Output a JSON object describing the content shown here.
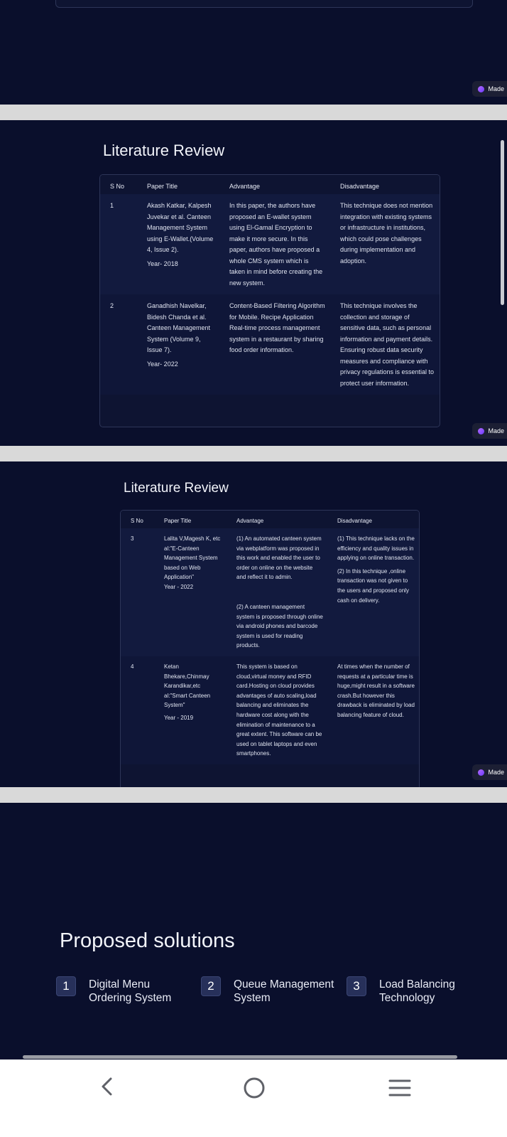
{
  "made_badge": "Made",
  "slide_lit1": {
    "title": "Literature Review",
    "headers": [
      "S No",
      "Paper Title",
      "Advantage",
      "Disadvantage"
    ],
    "rows": [
      {
        "sno": "1",
        "paper": "Akash Katkar, Kalpesh Juvekar et al. Canteen Management System using E-Wallet.(Volume 4, Issue 2).",
        "year": "Year- 2018",
        "advantage": "In this paper, the authors have proposed an E-wallet system using El-Gamal Encryption to make it more secure. In this paper, authors have proposed a whole CMS system which is taken in mind before creating the new system.",
        "disadvantage": "This technique does not mention integration with existing systems or infrastructure in institutions, which could pose challenges during implementation and adoption."
      },
      {
        "sno": "2",
        "paper": "Ganadhish Navelkar, Bidesh Chanda et al. Canteen Management System (Volume 9, Issue 7).",
        "year": "Year- 2022",
        "advantage": "Content-Based Filtering Algorithm for Mobile. Recipe Application Real-time process management system in a restaurant by sharing food order information.",
        "disadvantage": "This technique involves the collection and storage of sensitive data, such as personal information and payment details. Ensuring robust data security measures and compliance with privacy regulations is essential to protect user information."
      }
    ]
  },
  "slide_lit2": {
    "title": "Literature Review",
    "headers": [
      "S No",
      "Paper Title",
      "Advantage",
      "Disadvantage"
    ],
    "rows": [
      {
        "sno": "3",
        "paper": "Lalita V,Magesh K, etc al:\"E-Canteen Management System based on Web Application\"",
        "year": "Year - 2022",
        "advantage": "(1) An automated canteen system via webplatform was proposed in this work and enabled the user to order on online on the website and reflect it to admin.",
        "advantage2": "(2) A canteen management system is proposed through online via android phones and barcode system is used for reading products.",
        "disadvantage": "(1) This technique lacks on the efficiency and quality issues in applying on online transaction.",
        "disadvantage2": "(2) In this technique ,online transaction was not given to the users and proposed only cash on delivery."
      },
      {
        "sno": "4",
        "paper": "Ketan Bhekare,Chinmay Karandikar,etc al:\"Smart Canteen System\"",
        "year": "Year - 2019",
        "advantage": "This system is based on cloud,virtual money and RFID card.Hosting on cloud provides advantages of auto scaling,load balancing and eliminates the hardware cost along with the elimination of maintenance to a great extent. This software can be used on tablet laptops and even smartphones.",
        "disadvantage": "At times when the number of requests at a particular time is huge,might result in a software crash.But however this drawback is eliminated by load balancing feature of cloud."
      }
    ]
  },
  "slide_sol": {
    "title": "Proposed solutions",
    "items": [
      {
        "num": "1",
        "label": "Digital Menu Ordering System"
      },
      {
        "num": "2",
        "label": "Queue Management System"
      },
      {
        "num": "3",
        "label": "Load Balancing Technology"
      }
    ]
  },
  "colors": {
    "background": "#0a0f2c",
    "gap": "#d9d9d9",
    "navbar": "#ffffff"
  },
  "icons": [
    "back-icon",
    "home-icon",
    "menu-icon",
    "made-badge-icon"
  ]
}
